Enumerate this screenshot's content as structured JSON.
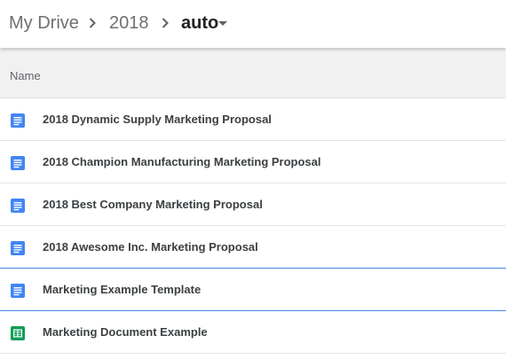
{
  "breadcrumb": {
    "items": [
      {
        "label": "My Drive"
      },
      {
        "label": "2018"
      },
      {
        "label": "auto"
      }
    ]
  },
  "list": {
    "column_header": "Name",
    "files": [
      {
        "name": "2018 Dynamic Supply Marketing Proposal",
        "type": "doc"
      },
      {
        "name": "2018 Champion Manufacturing Marketing Proposal",
        "type": "doc"
      },
      {
        "name": "2018 Best Company Marketing Proposal",
        "type": "doc"
      },
      {
        "name": "2018 Awesome Inc. Marketing Proposal",
        "type": "doc"
      },
      {
        "name": "Marketing Example Template",
        "type": "doc"
      },
      {
        "name": "Marketing Document Example",
        "type": "sheet"
      }
    ]
  },
  "colors": {
    "doc_icon": "#4285f4",
    "sheet_icon": "#0f9d58",
    "selection_border": "#4a86e8"
  }
}
